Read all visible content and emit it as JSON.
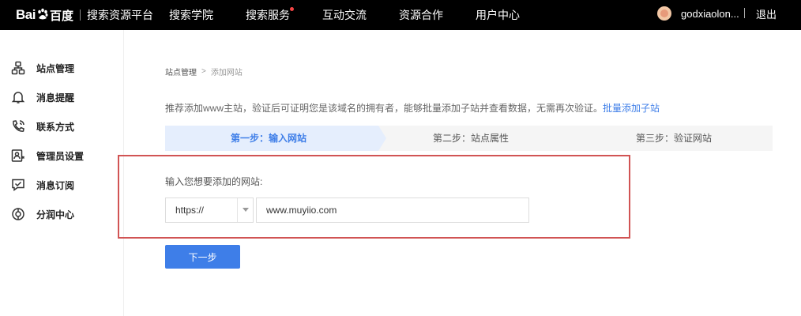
{
  "header": {
    "logo_text_bai": "Bai",
    "logo_text_du": "百度",
    "platform": "搜索资源平台",
    "nav": [
      {
        "label": "搜索学院",
        "dot": false
      },
      {
        "label": "搜索服务",
        "dot": true
      },
      {
        "label": "互动交流",
        "dot": false
      },
      {
        "label": "资源合作",
        "dot": false
      },
      {
        "label": "用户中心",
        "dot": false
      }
    ],
    "username": "godxiaolon...",
    "logout": "退出",
    "icons": {
      "logo": "baidu-paw-icon",
      "avatar": "user-avatar"
    },
    "colors": {
      "background": "#000000",
      "dot": "#f54545"
    }
  },
  "sidebar": {
    "items": [
      {
        "label": "站点管理",
        "icon": "site-management-icon"
      },
      {
        "label": "消息提醒",
        "icon": "bell-icon"
      },
      {
        "label": "联系方式",
        "icon": "phone-icon"
      },
      {
        "label": "管理员设置",
        "icon": "admin-settings-icon"
      },
      {
        "label": "消息订阅",
        "icon": "message-subscribe-icon"
      },
      {
        "label": "分润中心",
        "icon": "revenue-share-icon"
      }
    ]
  },
  "main": {
    "breadcrumb": [
      "站点管理",
      "添加网站"
    ],
    "intro_text": "推荐添加www主站，验证后可证明您是该域名的拥有者，能够批量添加子站并查看数据，无需再次验证。",
    "intro_link": "批量添加子站",
    "steps": [
      {
        "label": "第一步：输入网站",
        "active": true
      },
      {
        "label": "第二步：站点属性",
        "active": false
      },
      {
        "label": "第三步：验证网站",
        "active": false
      }
    ],
    "field_label": "输入您想要添加的网站:",
    "protocol": "https://",
    "url_value": "www.muyiio.com",
    "next_button": "下一步"
  },
  "colors": {
    "accent": "#3e7ee8",
    "highlight_border": "#d15454",
    "step_active_bg": "#e5eefd"
  }
}
